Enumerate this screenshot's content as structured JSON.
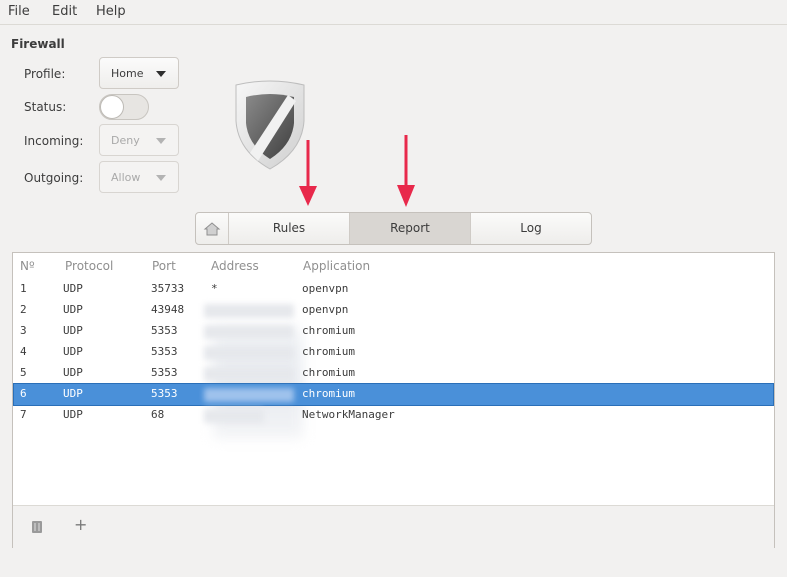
{
  "menu": [
    "File",
    "Edit",
    "Help"
  ],
  "section_title": "Firewall",
  "form": {
    "profile_label": "Profile:",
    "profile_value": "Home",
    "status_label": "Status:",
    "status_on": false,
    "incoming_label": "Incoming:",
    "incoming_value": "Deny",
    "outgoing_label": "Outgoing:",
    "outgoing_value": "Allow"
  },
  "tabs": {
    "home_icon": "home-icon",
    "items": [
      {
        "label": "Rules",
        "active": false
      },
      {
        "label": "Report",
        "active": true
      },
      {
        "label": "Log",
        "active": false
      }
    ]
  },
  "table": {
    "headers": [
      "Nº",
      "Protocol",
      "Port",
      "Address",
      "Application"
    ],
    "rows": [
      {
        "n": "1",
        "protocol": "UDP",
        "port": "35733",
        "address": "*",
        "application": "openvpn",
        "selected": false
      },
      {
        "n": "2",
        "protocol": "UDP",
        "port": "43948",
        "address": "",
        "application": "openvpn",
        "selected": false
      },
      {
        "n": "3",
        "protocol": "UDP",
        "port": "5353",
        "address": "",
        "application": "chromium",
        "selected": false
      },
      {
        "n": "4",
        "protocol": "UDP",
        "port": "5353",
        "address": "",
        "application": "chromium",
        "selected": false
      },
      {
        "n": "5",
        "protocol": "UDP",
        "port": "5353",
        "address": "",
        "application": "chromium",
        "selected": false
      },
      {
        "n": "6",
        "protocol": "UDP",
        "port": "5353",
        "address": "",
        "application": "chromium",
        "selected": true
      },
      {
        "n": "7",
        "protocol": "UDP",
        "port": "68",
        "address": "",
        "application": "NetworkManager",
        "selected": false
      }
    ]
  },
  "footer": {
    "icons": [
      "trash-icon",
      "add-icon"
    ],
    "add_label": "+"
  },
  "colors": {
    "selection": "#4a90d9",
    "annotation_arrow": "#e8294b"
  }
}
